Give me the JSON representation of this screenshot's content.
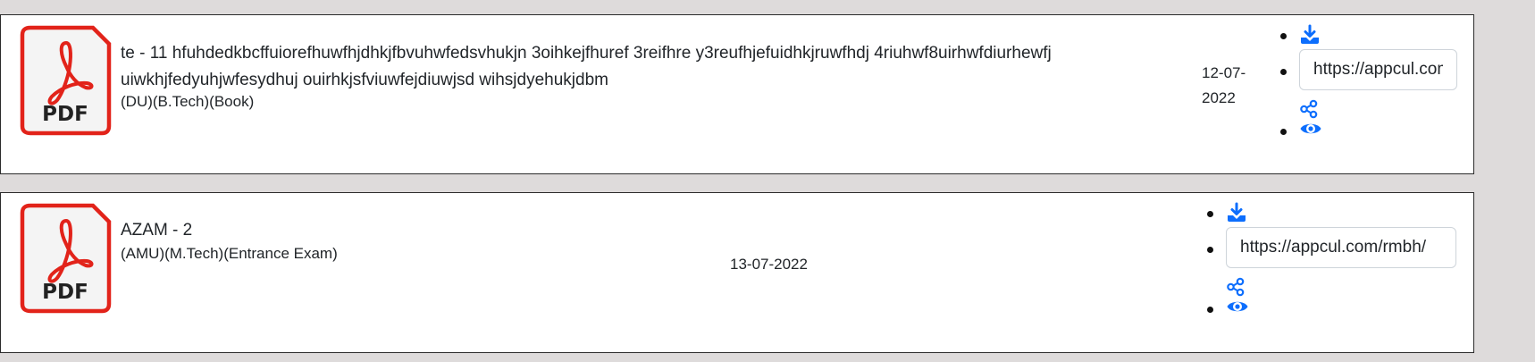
{
  "colors": {
    "pdf_red": "#e2231a",
    "action_blue": "#0d6efd",
    "page_bg": "#dedbdb"
  },
  "pdf_icon": {
    "label": "PDF"
  },
  "items": [
    {
      "title": "te - 11 hfuhdedkbcffuiorefhuwfhjdhkjfbvuhwfedsvhukjn 3oihkejfhuref 3reifhre y3reufhjefuidhkjruwfhdj 4riuhwf8uirhwfdiurhewfj uiwkhjfedyuhjwfesydhuj ouirhkjsfviuwfejdiuwjsd wihsjdyehukjdbm",
      "meta": "(DU)(B.Tech)(Book)",
      "date": "12-07-2022",
      "link_value": "https://appcul.com/rmbh/"
    },
    {
      "title": "AZAM - 2",
      "meta": "(AMU)(M.Tech)(Entrance Exam)",
      "date": "13-07-2022",
      "link_value": "https://appcul.com/rmbh/"
    }
  ],
  "icons": {
    "download": "download-icon",
    "share": "share-icon",
    "view": "eye-icon",
    "file": "pdf-file-icon"
  }
}
